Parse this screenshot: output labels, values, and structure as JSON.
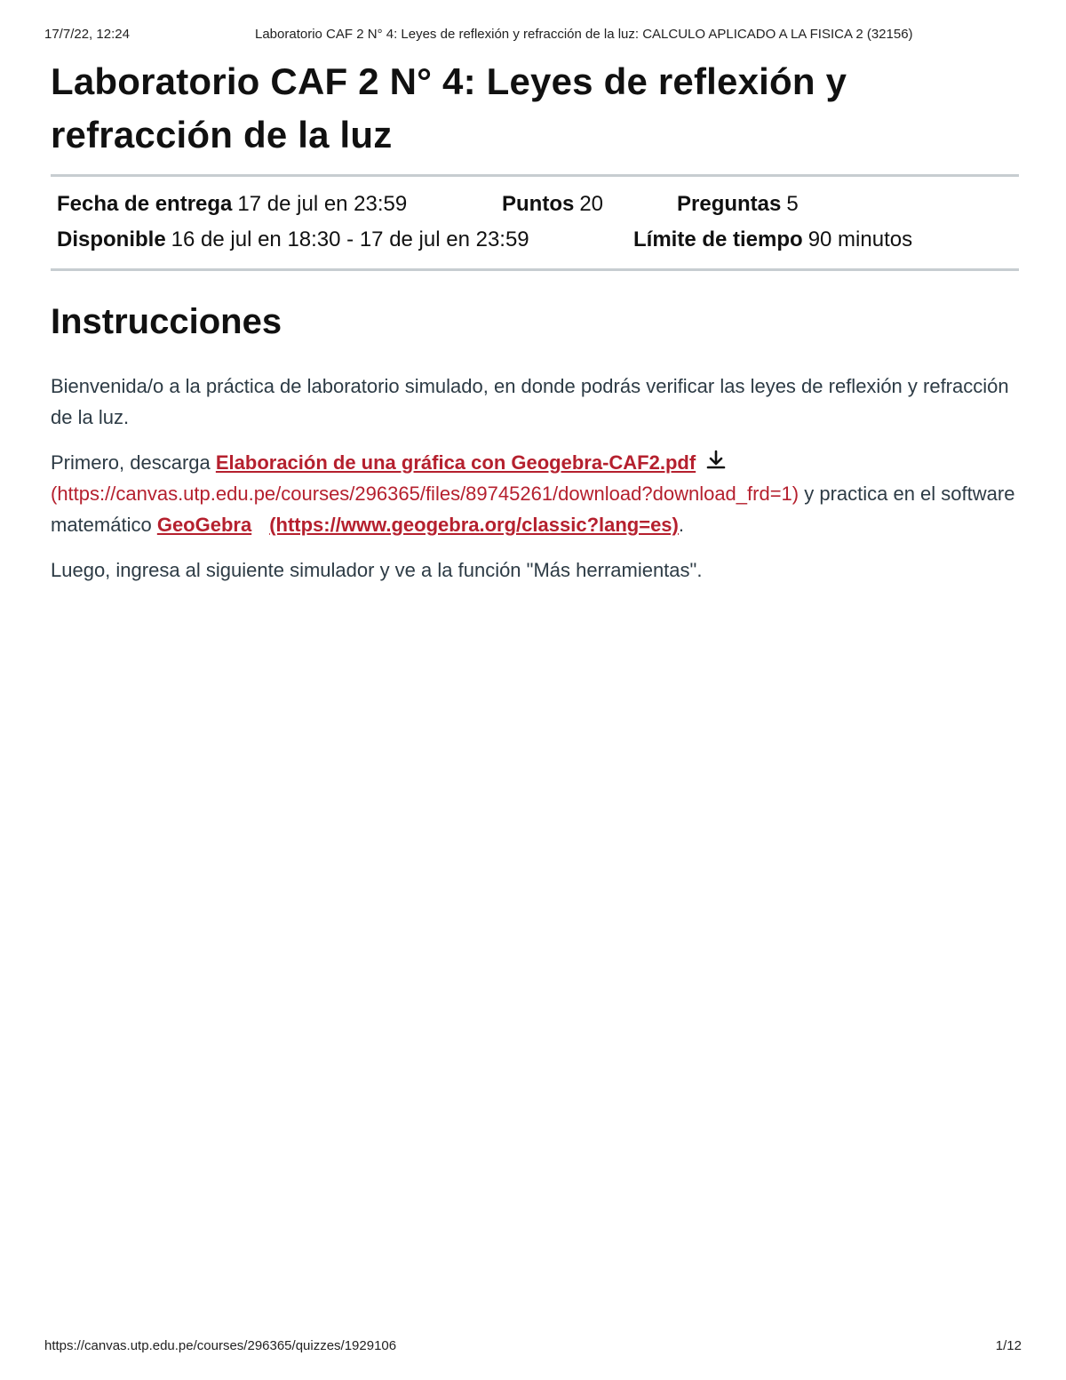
{
  "print_header": {
    "date": "17/7/22, 12:24",
    "title": "Laboratorio CAF 2 N° 4: Leyes de reflexión y refracción de la luz: CALCULO APLICADO A LA FISICA 2 (32156)"
  },
  "quiz": {
    "title_line1": "Laboratorio CAF 2 N° 4: Leyes de reflexión y",
    "title_line2": "refracción de la luz",
    "details": {
      "due_label": "Fecha de entrega",
      "due_value": "17 de jul en 23:59",
      "points_label": "Puntos",
      "points_value": "20",
      "questions_label": "Preguntas",
      "questions_value": "5",
      "available_label": "Disponible",
      "available_value": "16 de jul en 18:30 - 17 de jul en 23:59",
      "time_limit_label": "Límite de tiempo",
      "time_limit_value": "90 minutos"
    }
  },
  "instructions": {
    "heading": "Instrucciones",
    "p1": "Bienvenida/o a la práctica de laboratorio simulado, en donde podrás verificar las leyes de reflexión y refracción de la luz.",
    "p2_prefix": "Primero, descarga ",
    "p2_file_link": "Elaboración de una gráfica con Geogebra-CAF2.pdf",
    "p2_file_url": "(https://canvas.utp.edu.pe/courses/296365/files/89745261/download?download_frd=1)",
    "p2_middle": " y practica en el software matemático ",
    "p2_geogebra_link": "GeoGebra",
    "p2_geogebra_url": "(https://www.geogebra.org/classic?lang=es)",
    "p2_suffix": ".",
    "p3": "Luego, ingresa al siguiente simulador y ve a la función \"Más herramientas\"."
  },
  "print_footer": {
    "url": "https://canvas.utp.edu.pe/courses/296365/quizzes/1929106",
    "page": "1/12"
  },
  "icons": {
    "download": "download-icon"
  },
  "colors": {
    "link": "#b5202e",
    "text": "#2d3b45",
    "rule": "#c7cdd1"
  }
}
